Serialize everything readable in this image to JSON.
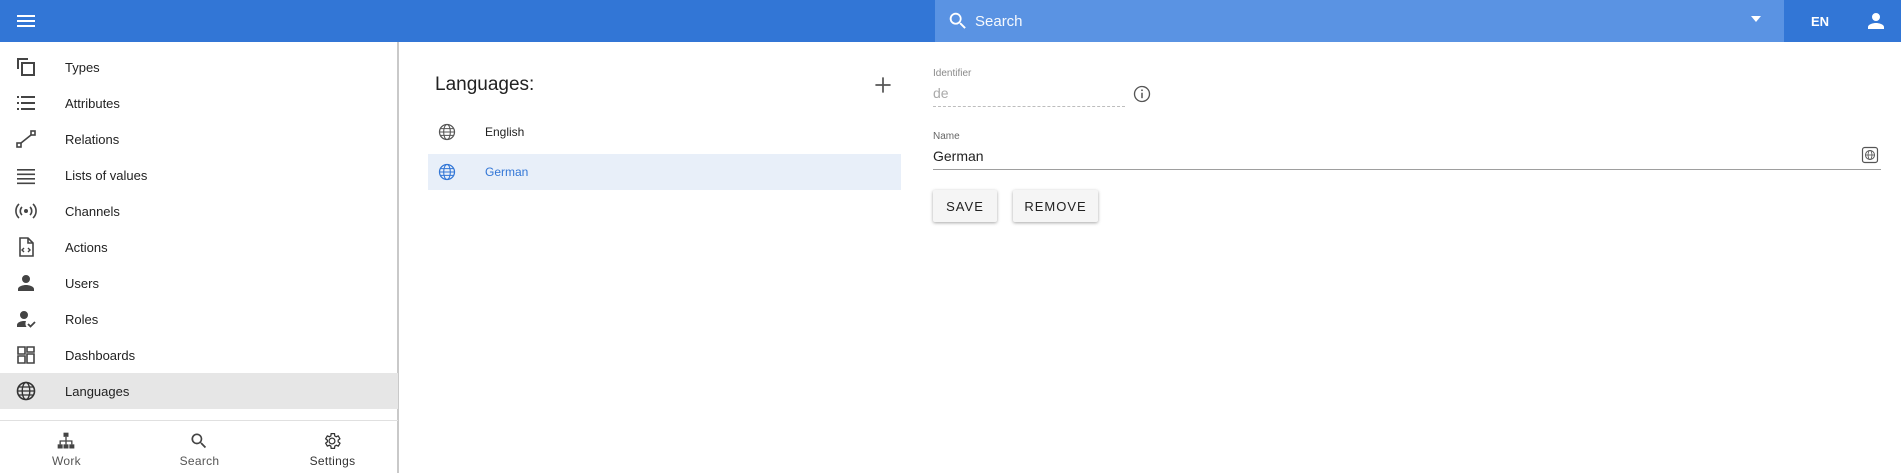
{
  "appbar": {
    "search_placeholder": "Search",
    "language": "EN",
    "bar_color": "#3276d6"
  },
  "sidebar": {
    "items": [
      {
        "label": "Types",
        "icon": "types-icon"
      },
      {
        "label": "Attributes",
        "icon": "attributes-list-icon"
      },
      {
        "label": "Relations",
        "icon": "relations-icon"
      },
      {
        "label": "Lists of values",
        "icon": "list-icon"
      },
      {
        "label": "Channels",
        "icon": "channels-icon"
      },
      {
        "label": "Actions",
        "icon": "actions-file-icon"
      },
      {
        "label": "Users",
        "icon": "user-icon"
      },
      {
        "label": "Roles",
        "icon": "role-check-icon"
      },
      {
        "label": "Dashboards",
        "icon": "dashboard-icon"
      },
      {
        "label": "Languages",
        "icon": "globe-icon",
        "active": true
      }
    ],
    "bottom_nav": [
      {
        "label": "Work",
        "icon": "sitemap-icon"
      },
      {
        "label": "Search",
        "icon": "search-icon"
      },
      {
        "label": "Settings",
        "icon": "gear-icon",
        "active": true
      }
    ]
  },
  "languages": {
    "title": "Languages:",
    "items": [
      {
        "label": "English"
      },
      {
        "label": "German",
        "selected": true
      }
    ]
  },
  "form": {
    "identifier_label": "Identifier",
    "identifier_value": "de",
    "name_label": "Name",
    "name_value": "German",
    "save_label": "SAVE",
    "remove_label": "REMOVE"
  }
}
